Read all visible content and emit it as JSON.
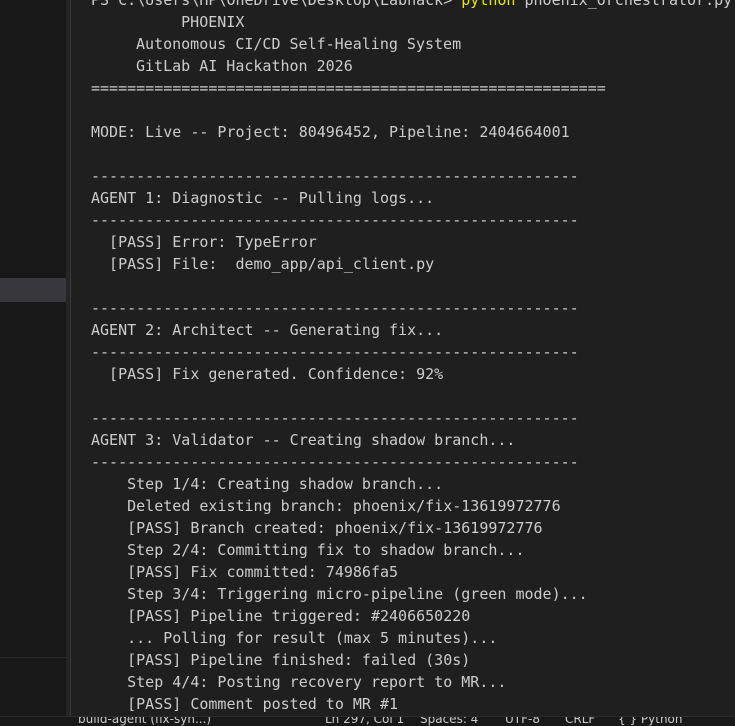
{
  "terminal": {
    "command": {
      "path": "PS C:\\Users\\HP\\OneDrive\\Desktop\\Labhack>",
      "python": "python",
      "file": "phoenix_orchestrator.py"
    },
    "lines": [
      "     PHOENIX",
      "Autonomous CI/CD Self-Healing System",
      "GitLab AI Hackathon 2026",
      "=========================================================",
      "MODE: Live -- Project: 80496452, Pipeline: 2404664001",
      "------------------------------------------------------",
      "AGENT 1: Diagnostic -- Pulling logs...",
      "------------------------------------------------------",
      "  [PASS] Error: TypeError",
      "  [PASS] File:  demo_app/api_client.py",
      "------------------------------------------------------",
      "AGENT 2: Architect -- Generating fix...",
      "------------------------------------------------------",
      "  [PASS] Fix generated. Confidence: 92%",
      "------------------------------------------------------",
      "AGENT 3: Validator -- Creating shadow branch...",
      "------------------------------------------------------",
      "    Step 1/4: Creating shadow branch...",
      "    Deleted existing branch: phoenix/fix-13619972776",
      "    [PASS] Branch created: phoenix/fix-13619972776",
      "    Step 2/4: Committing fix to shadow branch...",
      "    [PASS] Fix committed: 74986fa5",
      "    Step 3/4: Triggering micro-pipeline (green mode)...",
      "    [PASS] Pipeline triggered: #2406650220",
      "    ... Polling for result (max 5 minutes)...",
      "    [PASS] Pipeline finished: failed (30s)",
      "    Step 4/4: Posting recovery report to MR...",
      "    [PASS] Comment posted to MR #1"
    ]
  },
  "statusbar": {
    "branch": "build-agent (fix-syn...)",
    "cursor": "Ln 297, Col 1",
    "spaces": "Spaces: 4",
    "encoding": "UTF-8",
    "eol": "CRLF",
    "language": "{ } Python"
  }
}
